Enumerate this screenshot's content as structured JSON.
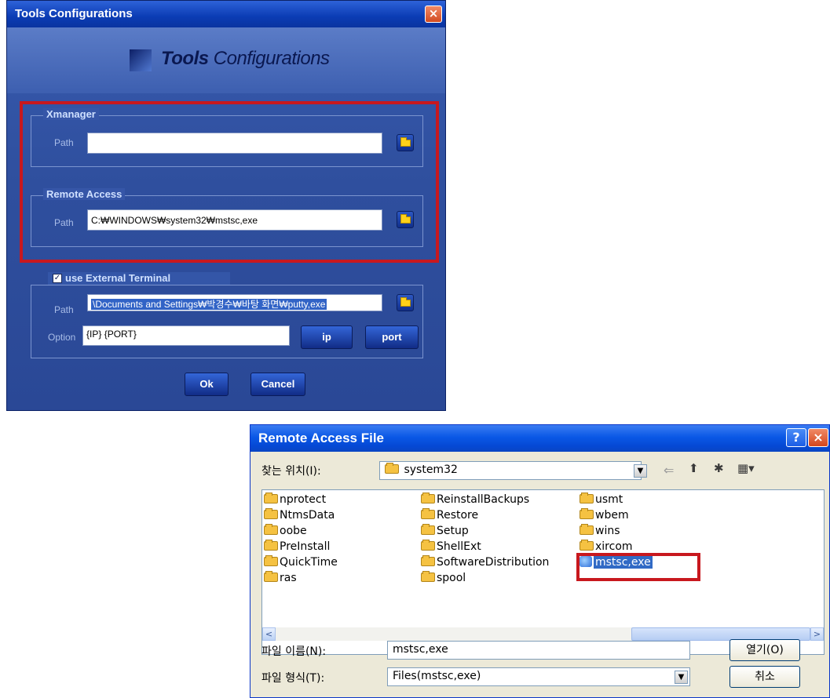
{
  "tools_dialog": {
    "window_title": "Tools Configurations",
    "close_glyph": "×",
    "banner_title_bold": "Tools",
    "banner_title_rest": " Configurations",
    "xmanager": {
      "group_title": "Xmanager",
      "path_label": "Path",
      "path_value": ""
    },
    "remote_access": {
      "group_title": "Remote Access",
      "path_label": "Path",
      "path_value": "C:₩WINDOWS₩system32₩mstsc,exe"
    },
    "external_terminal": {
      "checkbox_checked": true,
      "checkbox_glyph": "✓",
      "group_title": "use External Terminal",
      "path_label": "Path",
      "path_value": "\\Documents and Settings₩박경수₩바탕 화면₩putty,exe",
      "option_label": "Option",
      "option_value": "{IP}  {PORT}",
      "ip_button": "ip",
      "port_button": "port"
    },
    "ok_button": "Ok",
    "cancel_button": "Cancel"
  },
  "file_dialog": {
    "window_title": "Remote Access File",
    "help_glyph": "?",
    "close_glyph": "×",
    "look_in_label": "찾는 위치(I):",
    "look_in_value": "system32",
    "toolbar_glyphs": {
      "back": "⇐",
      "up": "⬆",
      "new_folder": "✱",
      "views": "▦▾"
    },
    "columns": [
      [
        "nprotect",
        "NtmsData",
        "oobe",
        "PreInstall",
        "QuickTime",
        "ras"
      ],
      [
        "ReinstallBackups",
        "Restore",
        "Setup",
        "ShellExt",
        "SoftwareDistribution",
        "spool"
      ],
      [
        "usmt",
        "wbem",
        "wins",
        "xircom"
      ]
    ],
    "selected_file": "mstsc,exe",
    "filename_label": "파일 이름(N):",
    "filename_value": "mstsc,exe",
    "filetype_label": "파일 형식(T):",
    "filetype_value": "Files(mstsc,exe)",
    "open_button": "열기(O)",
    "cancel_button": "취소",
    "scroll_left": "<",
    "scroll_right": ">",
    "dropdown_glyph": "▼"
  },
  "colors": {
    "highlight_red": "#c8181e",
    "xp_blue": "#0a58e6",
    "tools_bg": "#2a4896"
  }
}
